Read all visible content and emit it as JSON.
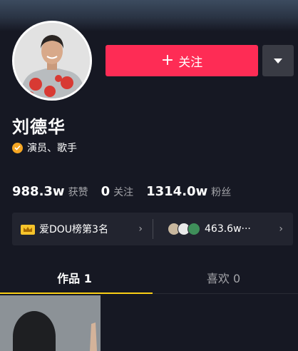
{
  "profile": {
    "name": "刘德华",
    "verification": "演员、歌手",
    "follow_label": "关注"
  },
  "stats": {
    "likes_value": "988.3w",
    "likes_label": "获赞",
    "following_value": "0",
    "following_label": "关注",
    "followers_value": "1314.0w",
    "followers_label": "粉丝"
  },
  "rank_bar": {
    "rank_text": "爱DOU榜第3名",
    "fans_text": "463.6w···"
  },
  "tabs": [
    {
      "label": "作品 1",
      "active": true
    },
    {
      "label": "喜欢 0",
      "active": false
    }
  ],
  "colors": {
    "background": "#161823",
    "follow_button": "#fe2c55",
    "tab_indicator": "#face15",
    "verify_badge": "#f5a623"
  },
  "icons": {
    "follow_plus": "plus-icon",
    "more": "caret-down-icon",
    "verify": "verified-check-icon",
    "rank": "crown-icon",
    "chevron": "chevron-right-icon"
  }
}
